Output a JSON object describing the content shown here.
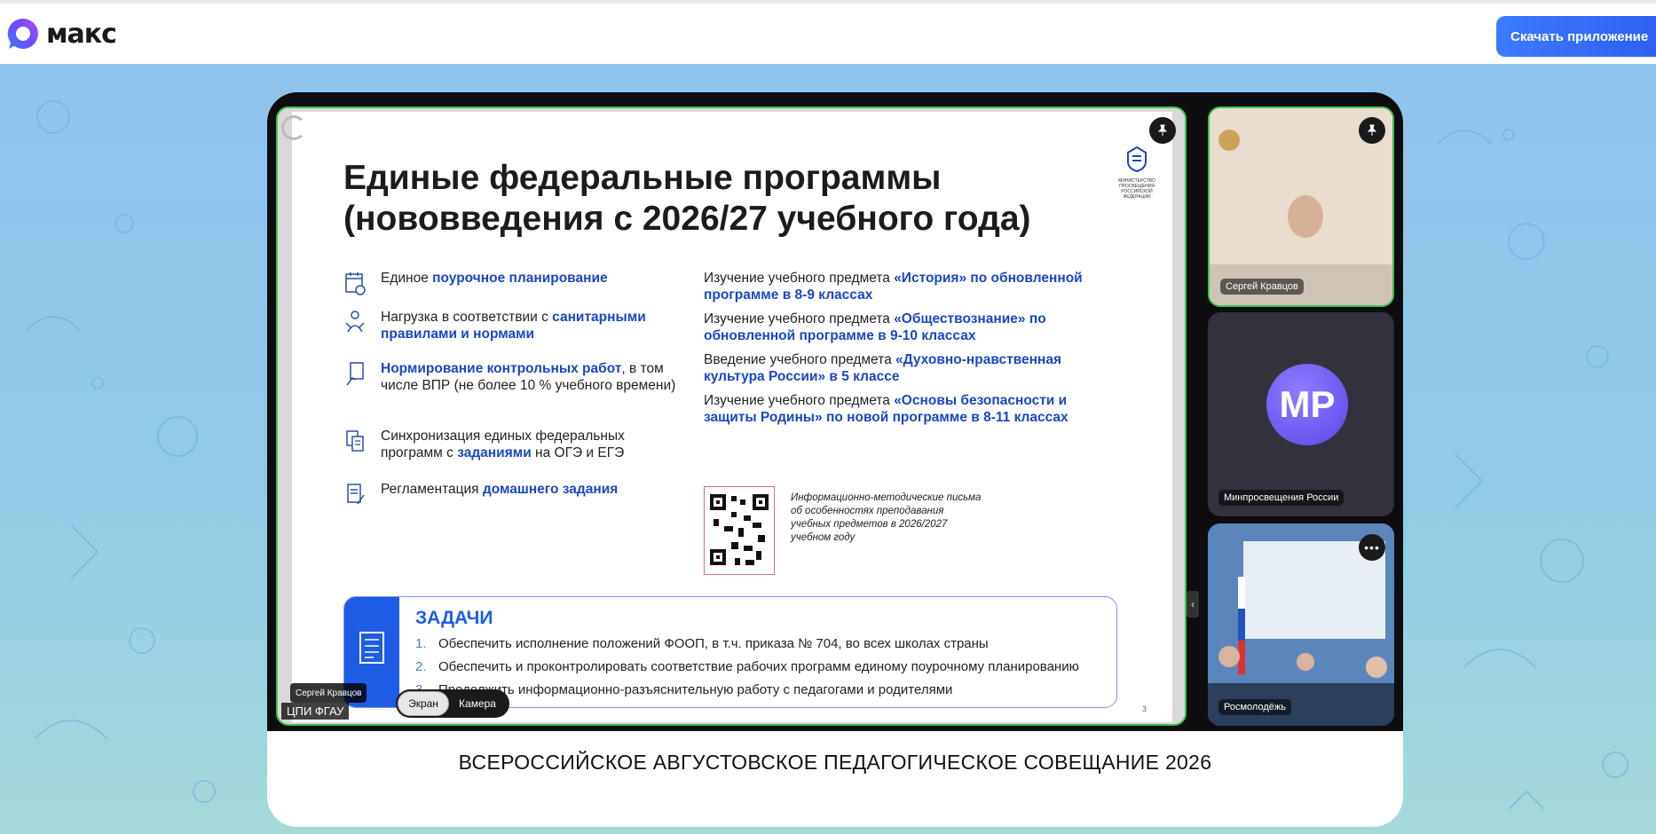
{
  "app": {
    "name": "макс",
    "download_label": "Скачать приложение"
  },
  "slide": {
    "title_line1": "Единые федеральные программы",
    "title_line2": "(нововведения с 2026/27 учебного года)",
    "ministry": "Министерство просвещения Российской Федерации",
    "left_items": [
      {
        "pre": "Единое ",
        "hl": "поурочное планирование",
        "post": ""
      },
      {
        "pre": "Нагрузка в соответствии с ",
        "hl": "санитарными правилами и нормами",
        "post": ""
      },
      {
        "pre": "",
        "hl": "Нормирование контрольных работ",
        "post": ", в том числе ВПР (не более 10 % учебного времени)"
      },
      {
        "pre": "Синхронизация единых федеральных программ с ",
        "hl": "заданиями",
        "post": " на ОГЭ и ЕГЭ"
      },
      {
        "pre": "Регламентация ",
        "hl": "домашнего задания",
        "post": ""
      }
    ],
    "right_items": [
      {
        "pre": "Изучение учебного предмета ",
        "hl": "«История» по обновленной программе в 8-9 классах"
      },
      {
        "pre": "Изучение учебного предмета ",
        "hl": "«Обществознание» по обновленной программе в 9-10 классах"
      },
      {
        "pre": "Введение учебного предмета ",
        "hl": "«Духовно-нравственная культура России» в 5 классе"
      },
      {
        "pre": "Изучение учебного предмета ",
        "hl": "«Основы безопасности и защиты Родины» по новой программе в 8-11 классах"
      }
    ],
    "qr_caption": "Информационно-методические письма об особенностях преподавания учебных предметов в 2026/2027 учебном году",
    "tasks_title": "ЗАДАЧИ",
    "tasks": [
      {
        "n": "1.",
        "text": "Обеспечить исполнение положений ФООП, в т.ч. приказа № 704, во всех школах страны"
      },
      {
        "n": "2.",
        "text": "Обеспечить и проконтролировать соответствие рабочих программ единому поурочному планированию"
      },
      {
        "n": "3.",
        "text": "Продолжить информационно-разъяснительную работу с педагогами и родителями"
      }
    ],
    "page_number": "3"
  },
  "video": {
    "source_label": "ЦПИ ФГАУ",
    "speaker_label": "Сергей Кравцов",
    "toggle": {
      "screen": "Экран",
      "camera": "Камера"
    },
    "participants": [
      {
        "name": "Сергей Кравцов"
      },
      {
        "name": "Минпросвещения России",
        "initials": "МР"
      },
      {
        "name": "Росмолодёжь"
      }
    ]
  },
  "caption": "ВСЕРОССИЙСКОЕ АВГУСТОВСКОЕ ПЕДАГОГИЧЕСКОЕ СОВЕЩАНИЕ 2026",
  "colors": {
    "accent": "#1a48c4",
    "button": "#2d5cf0",
    "active_speaker": "#3fc14b",
    "background": "#8ec4ee"
  }
}
